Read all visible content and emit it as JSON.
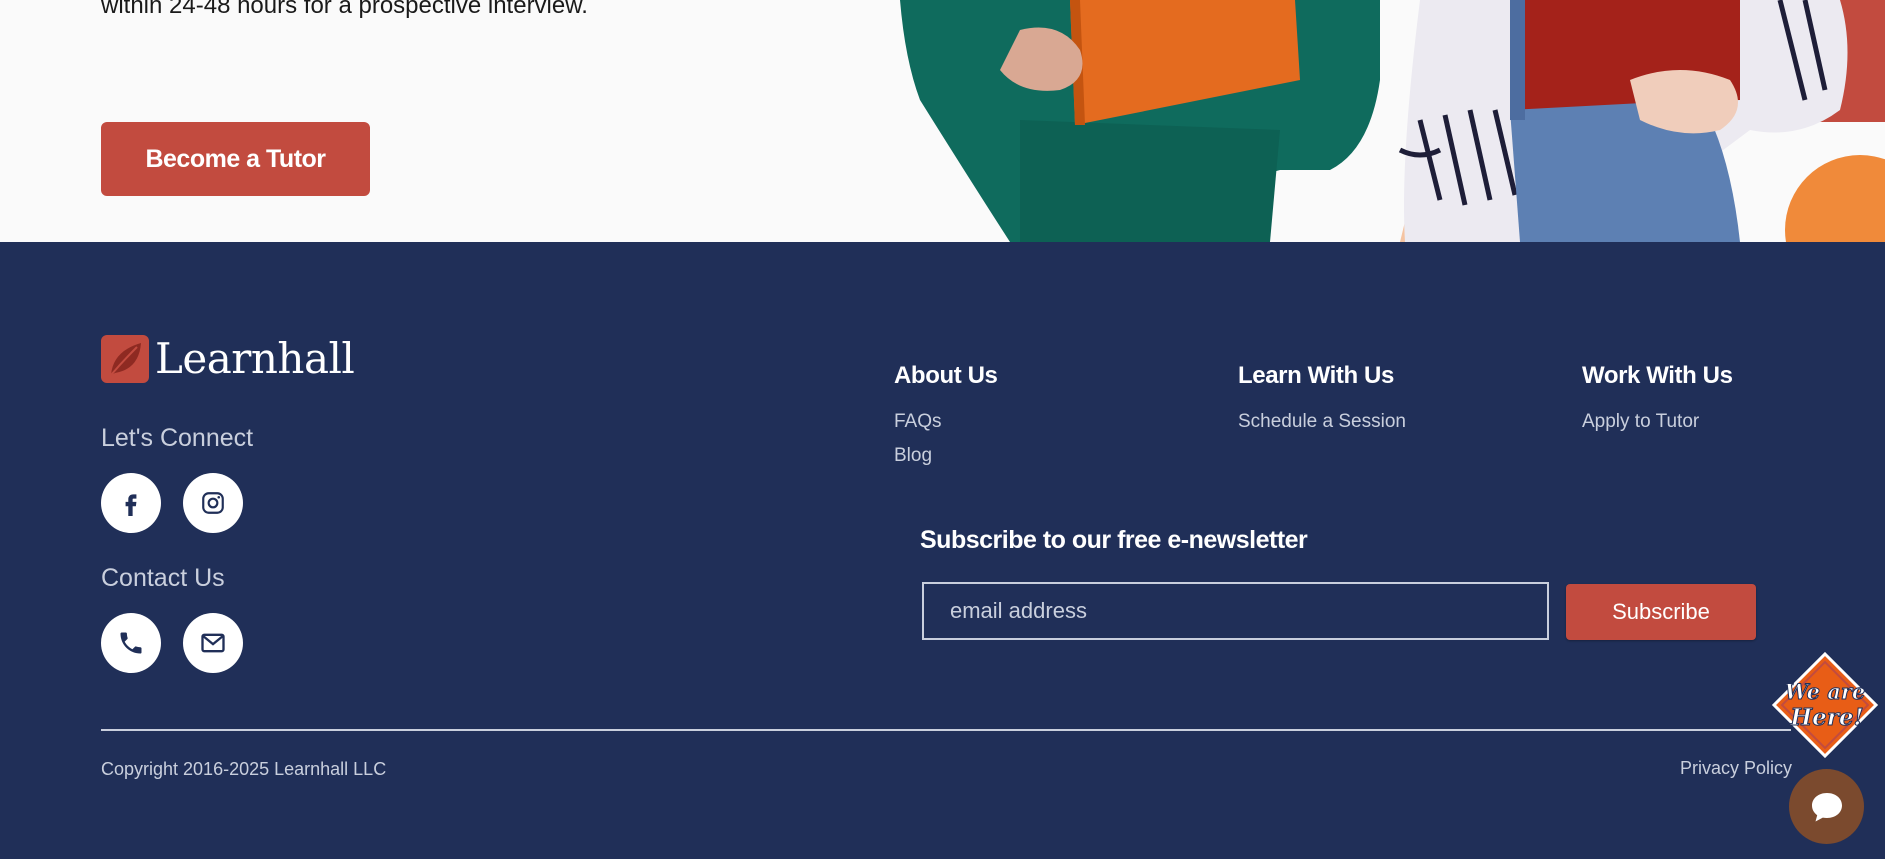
{
  "hero": {
    "text": "within 24-48 hours for a prospective interview.",
    "cta_label": "Become a Tutor"
  },
  "footer": {
    "brand": "Learnhall",
    "connect_title": "Let's Connect",
    "social": [
      "facebook-icon",
      "instagram-icon"
    ],
    "contact_title": "Contact Us",
    "contact": [
      "phone-icon",
      "mail-icon"
    ],
    "columns": [
      {
        "title": "About Us",
        "links": [
          "FAQs",
          "Blog"
        ]
      },
      {
        "title": "Learn With Us",
        "links": [
          "Schedule a Session"
        ]
      },
      {
        "title": "Work With Us",
        "links": [
          "Apply to Tutor"
        ]
      }
    ],
    "newsletter": {
      "title": "Subscribe to our free e-newsletter",
      "placeholder": "email address",
      "button": "Subscribe"
    },
    "copyright": "Copyright 2016-2025 Learnhall LLC",
    "privacy": "Privacy Policy"
  },
  "widgets": {
    "badge_line1": "We are",
    "badge_line2": "Here!",
    "chat_icon": "chat-bubble-icon"
  },
  "colors": {
    "footer_bg": "#202f58",
    "accent": "#c24b3f",
    "muted_text": "#c9cfdd"
  }
}
